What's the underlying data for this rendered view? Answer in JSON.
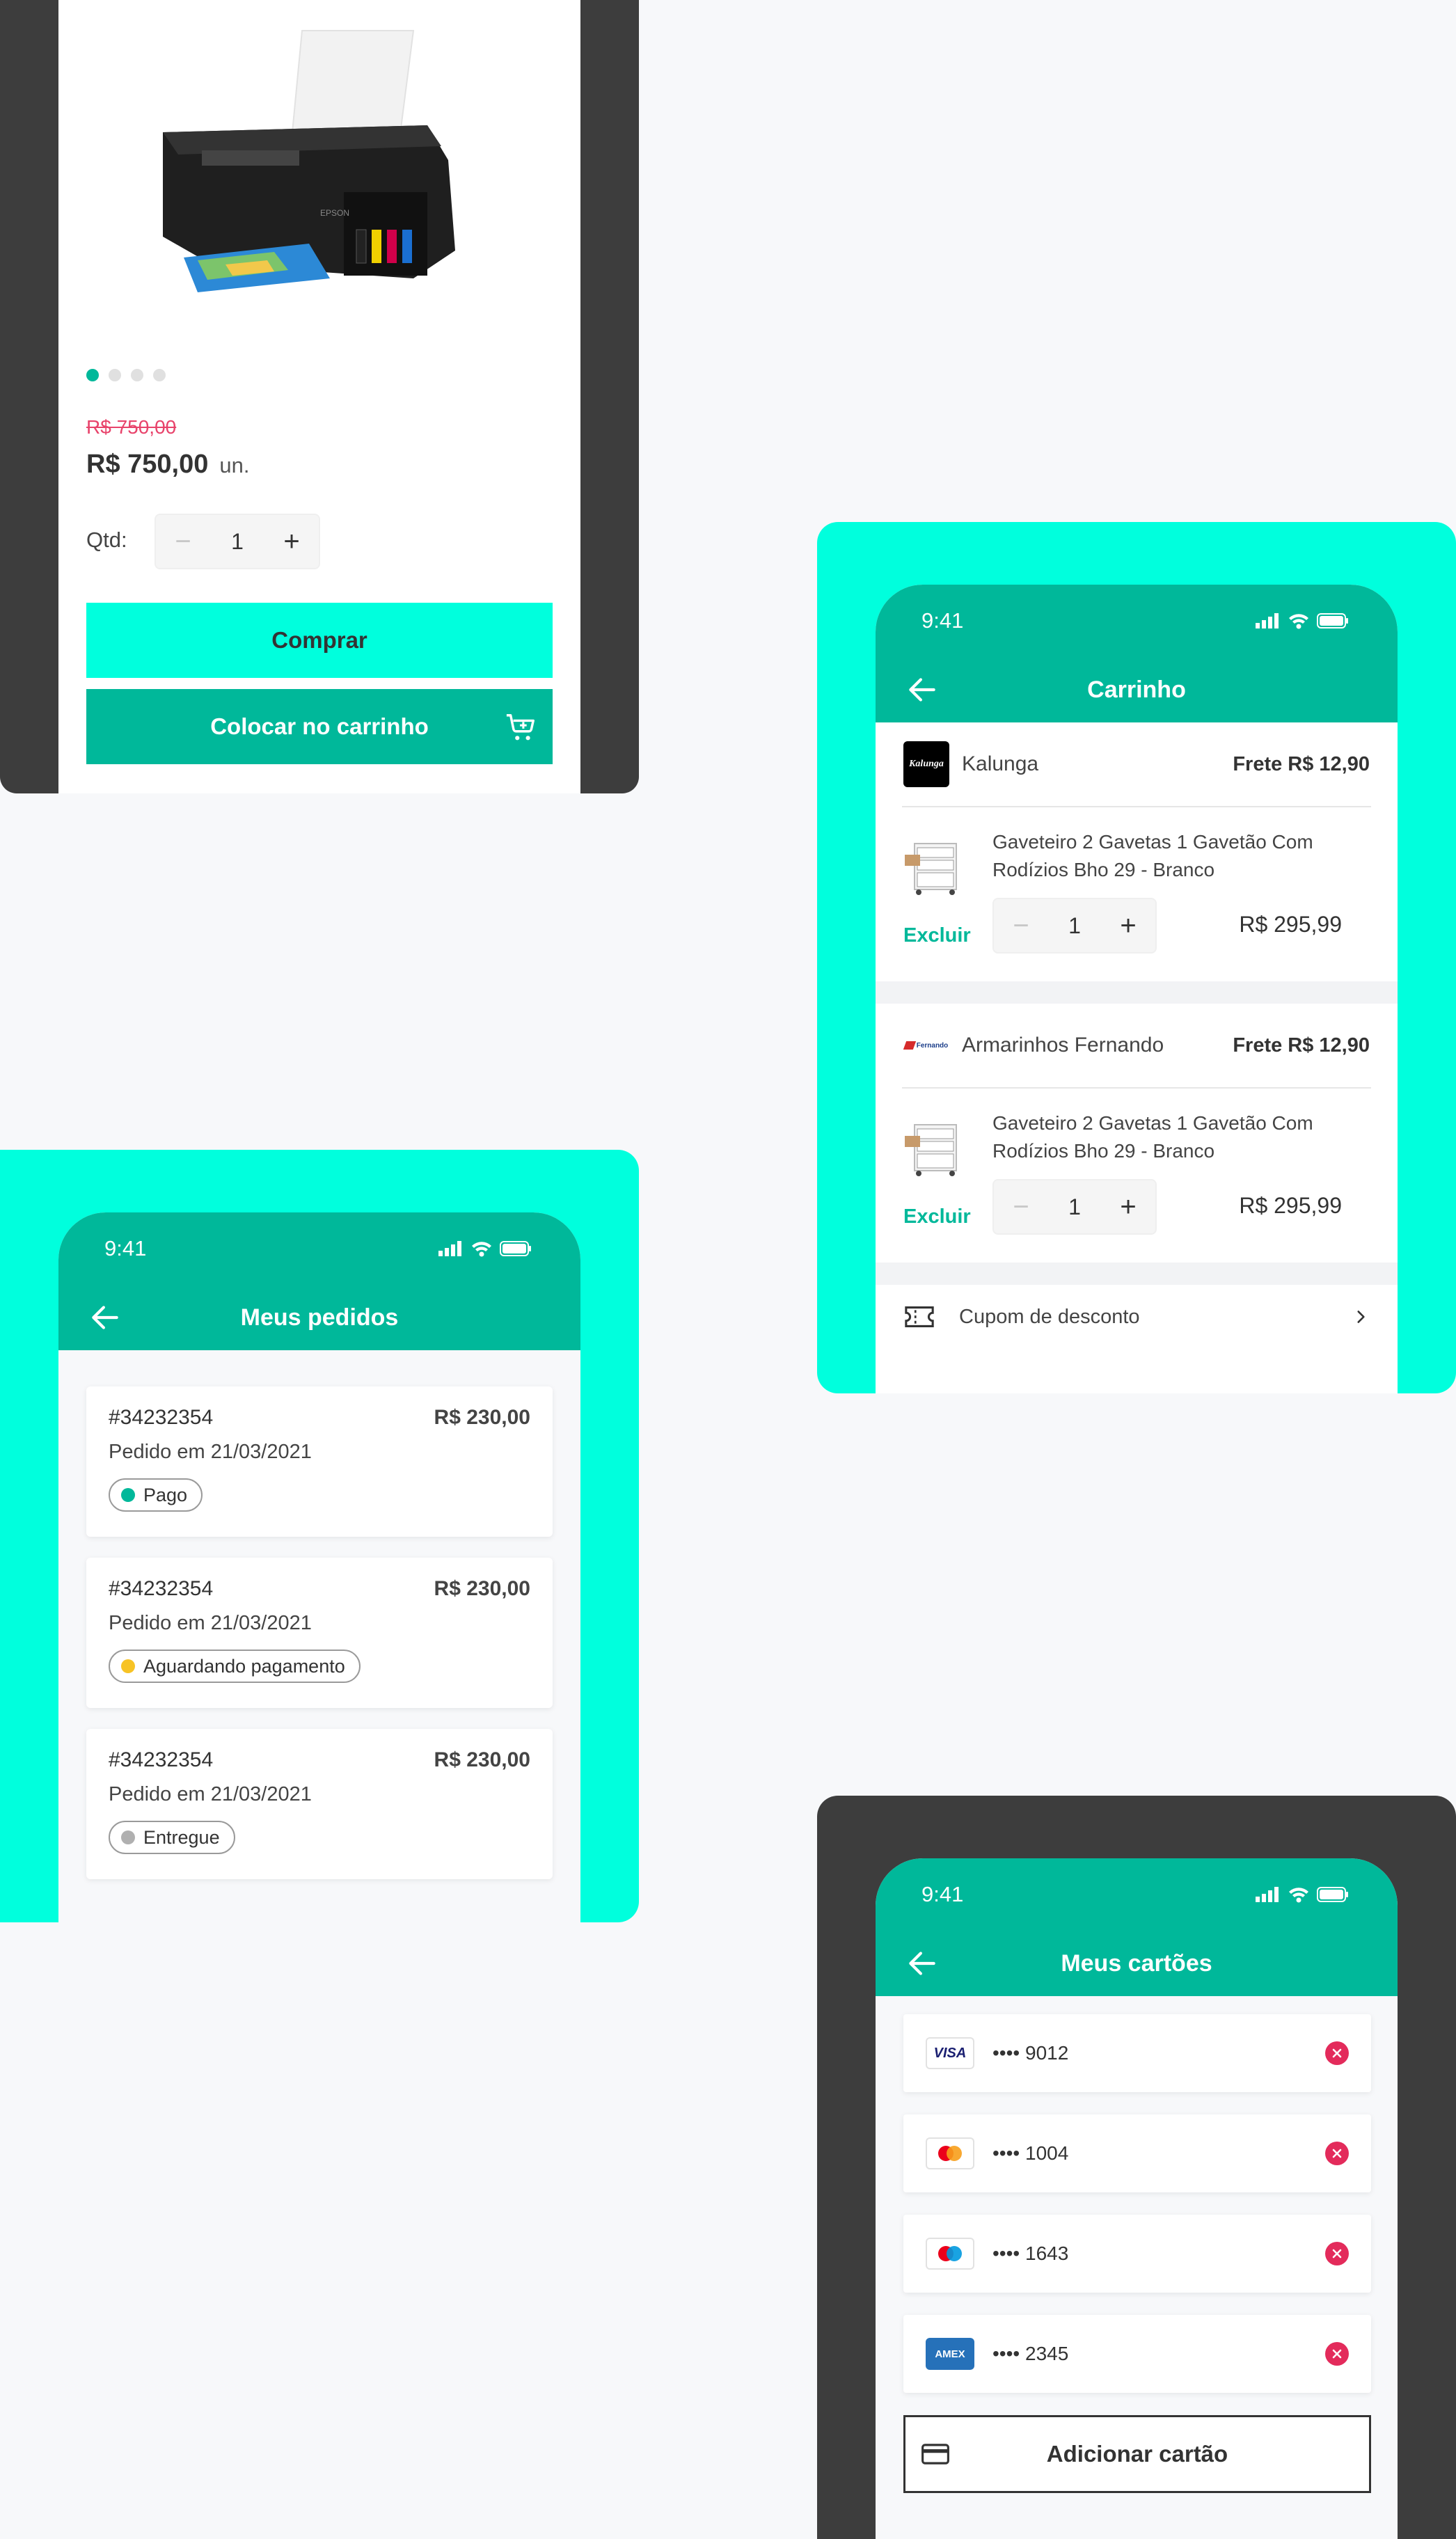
{
  "product": {
    "old_price": "R$ 750,00",
    "price": "R$ 750,00",
    "unit": "un.",
    "qty_label": "Qtd:",
    "qty": "1",
    "buy_label": "Comprar",
    "add_to_cart_label": "Colocar no carrinho",
    "gallery_count": 4,
    "gallery_active": 1
  },
  "cart": {
    "time": "9:41",
    "title": "Carrinho",
    "stores": [
      {
        "name": "Kalunga",
        "logo_text": "Kalunga",
        "freight": "Frete R$ 12,90",
        "item": {
          "title_line1": "Gaveteiro 2 Gavetas 1 Gavetão Com",
          "title_line2": "Rodízios Bho 29 - Branco",
          "remove": "Excluir",
          "qty": "1",
          "price": "R$ 295,99"
        }
      },
      {
        "name": "Armarinhos Fernando",
        "logo_text": "Fernando",
        "freight": "Frete R$ 12,90",
        "item": {
          "title_line1": "Gaveteiro 2 Gavetas 1 Gavetão Com",
          "title_line2": "Rodízios Bho 29 - Branco",
          "remove": "Excluir",
          "qty": "1",
          "price": "R$ 295,99"
        }
      }
    ],
    "coupon_label": "Cupom de desconto"
  },
  "orders": {
    "time": "9:41",
    "title": "Meus pedidos",
    "items": [
      {
        "id": "#34232354",
        "total": "R$ 230,00",
        "date": "Pedido em 21/03/2021",
        "status": "Pago",
        "status_color": "#00b89a"
      },
      {
        "id": "#34232354",
        "total": "R$ 230,00",
        "date": "Pedido em 21/03/2021",
        "status": "Aguardando pagamento",
        "status_color": "#f7c325"
      },
      {
        "id": "#34232354",
        "total": "R$ 230,00",
        "date": "Pedido em 21/03/2021",
        "status": "Entregue",
        "status_color": "#b0b0b0"
      }
    ]
  },
  "cards": {
    "time": "9:41",
    "title": "Meus cartões",
    "items": [
      {
        "brand": "visa",
        "brand_text": "VISA",
        "number": "•••• 9012"
      },
      {
        "brand": "mastercard",
        "number": "•••• 1004"
      },
      {
        "brand": "maestro",
        "number": "•••• 1643"
      },
      {
        "brand": "amex",
        "brand_text": "AMEX",
        "number": "•••• 2345"
      }
    ],
    "add_label": "Adicionar cartão"
  },
  "colors": {
    "primary": "#00b89a",
    "accent": "#00ffdd",
    "danger": "#e32b5b",
    "dark_panel": "#3d3d3d"
  }
}
